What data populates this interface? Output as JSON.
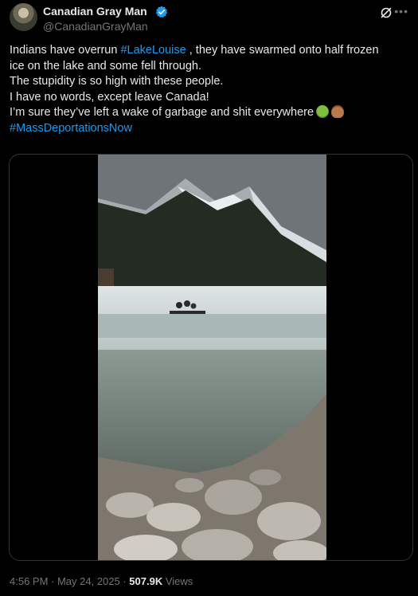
{
  "author": {
    "name": "Canadian Gray Man",
    "handle": "@CanadianGrayMan"
  },
  "icons": {
    "verified": "verified-badge-icon",
    "grok": "grok-icon",
    "more": "more-options-icon"
  },
  "post": {
    "l1_pre": "Indians have overrun ",
    "l1_tag": "#LakeLouise",
    "l1_post": " , they have swarmed onto half frozen",
    "l2": "ice on the lake and some fell through.",
    "l3": "The stupidity is so high with these people.",
    "l4": "I have no words, except leave Canada!",
    "l5": "I’m sure they’ve left a wake of garbage and shit everywhere",
    "l6_tag": "#MassDeportationsNow"
  },
  "meta": {
    "time": "4:56 PM · May 24, 2025 · ",
    "views_count": "507.9K",
    "views_label": " Views"
  },
  "colors": {
    "accent": "#1d9bf0",
    "secondary_text": "#71767b",
    "primary_text": "#e7e9ea",
    "background": "#000000"
  }
}
